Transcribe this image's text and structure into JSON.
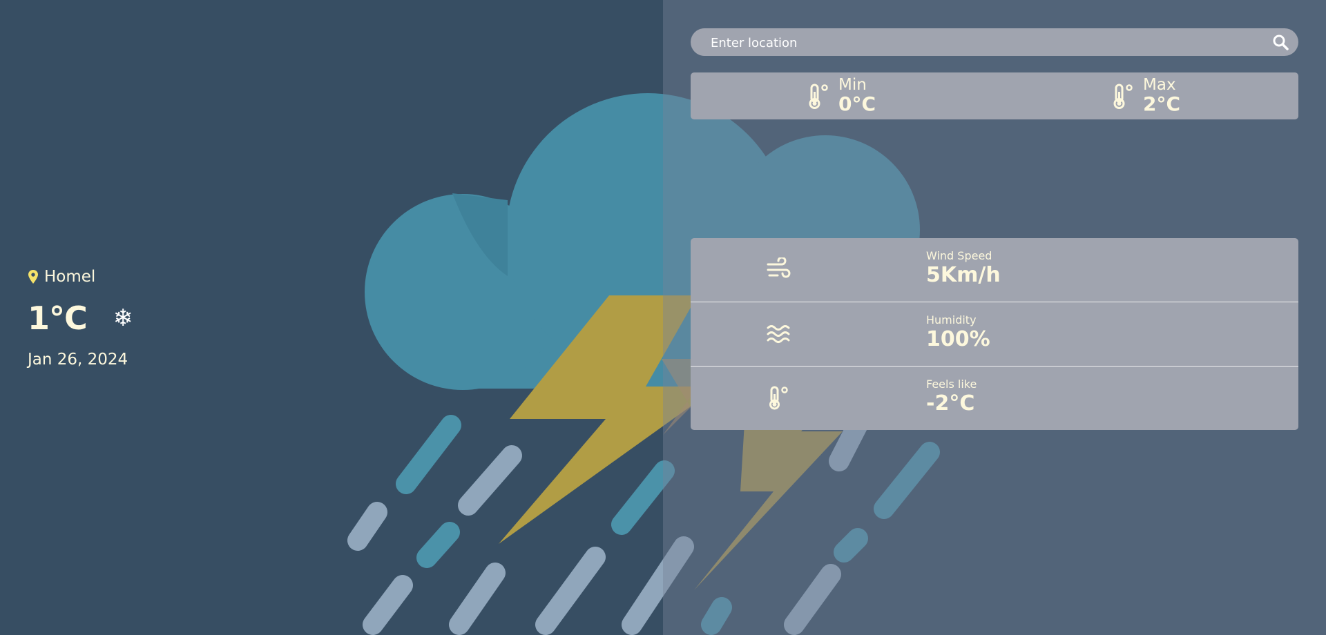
{
  "current": {
    "location": "Homel",
    "temperature": "1°C",
    "condition_icon": "snowflake-icon",
    "date": "Jan 26, 2024"
  },
  "search": {
    "placeholder": "Enter location",
    "icon": "search-icon"
  },
  "minmax": {
    "min_label": "Min",
    "min_value": "0°C",
    "max_label": "Max",
    "max_value": "2°C"
  },
  "details": [
    {
      "label": "Wind Speed",
      "value": "5Km/h",
      "icon": "wind-icon"
    },
    {
      "label": "Humidity",
      "value": "100%",
      "icon": "humidity-waves-icon"
    },
    {
      "label": "Feels like",
      "value": "-2°C",
      "icon": "thermometer-icon"
    }
  ],
  "colors": {
    "background": "#374e63",
    "card": "#a0a4af",
    "text": "#fdf8dd",
    "pin": "#f5e36a",
    "cloud": "#468ca4",
    "lightning": "#b19d45"
  }
}
